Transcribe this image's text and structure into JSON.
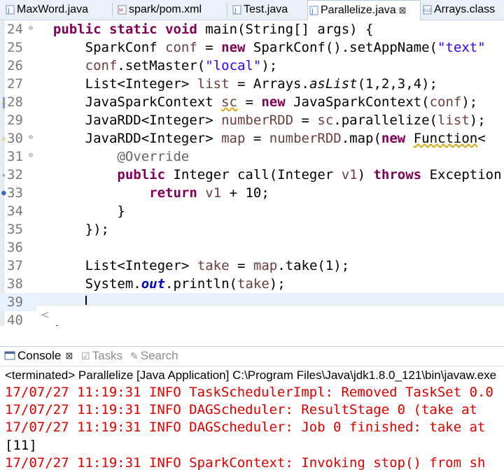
{
  "tabs": [
    {
      "label": "MaxWord.java",
      "icon": "java-file-icon"
    },
    {
      "label": "spark/pom.xml",
      "icon": "xml-file-icon"
    },
    {
      "label": "Test.java",
      "icon": "java-file-icon"
    },
    {
      "label": "Parallelize.java",
      "icon": "java-file-icon",
      "active": true,
      "close": "⊠"
    },
    {
      "label": "Arrays.class",
      "icon": "class-file-icon"
    }
  ],
  "editor": {
    "line_numbers": [
      "24",
      "25",
      "26",
      "27",
      "28",
      "29",
      "30",
      "31",
      "32",
      "33",
      "34",
      "35",
      "36",
      "37",
      "38",
      "39",
      "40"
    ]
  },
  "console": {
    "tabs": [
      {
        "label": "Console",
        "close": "⊠"
      },
      {
        "label": "Tasks"
      },
      {
        "label": "Search"
      }
    ],
    "description": "<terminated> Parallelize [Java Application] C:\\Program Files\\Java\\jdk1.8.0_121\\bin\\javaw.exe",
    "lines": [
      "17/07/27 11:19:31 INFO TaskSchedulerImpl: Removed TaskSet 0.0",
      "17/07/27 11:19:31 INFO DAGScheduler: ResultStage 0 (take at",
      "17/07/27 11:19:31 INFO DAGScheduler: Job 0 finished: take at",
      "[11]",
      "17/07/27 11:19:31 INFO SparkContext: Invoking stop() from sh"
    ]
  },
  "colors": {
    "keyword": "#7f0055",
    "string": "#2a00ff",
    "variable": "#6a3e3e",
    "field": "#0000c0",
    "annotation": "#646464",
    "console_error": "#e00000",
    "current_line": "#e8f2fe"
  }
}
